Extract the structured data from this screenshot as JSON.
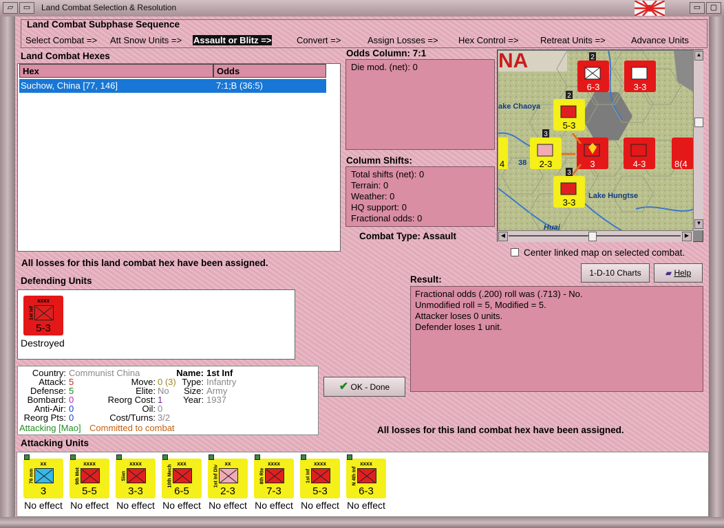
{
  "window": {
    "title": "Land Combat Selection & Resolution"
  },
  "sequence": {
    "title": "Land Combat Subphase Sequence",
    "steps": [
      "Select Combat =>",
      "Att Snow Units =>",
      "Assault or Blitz =>",
      "Convert =>",
      "Assign Losses =>",
      "Hex Control =>",
      "Retreat Units =>",
      "Advance Units"
    ],
    "active_step": "Assault or Blitz =>"
  },
  "hexes": {
    "label": "Land Combat Hexes",
    "col_hex": "Hex",
    "col_odds": "Odds",
    "rows": [
      {
        "hex": "Suchow, China [77, 146]",
        "odds": "7:1;B (36:5)"
      }
    ]
  },
  "odds": {
    "title": "Odds Column: 7:1",
    "die_mod": "Die mod. (net): 0"
  },
  "shifts": {
    "title": "Column Shifts:",
    "lines": [
      "Total shifts (net): 0",
      "Terrain: 0",
      "Weather: 0",
      "HQ support: 0",
      "Fractional odds: 0"
    ]
  },
  "combat_type": "Combat Type:  Assault",
  "center_map_label": "Center linked map on selected combat.",
  "losses_msg": "All losses for this land combat hex have been assigned.",
  "losses_msg2": "All losses for this land combat hex have been assigned.",
  "buttons": {
    "charts": "1-D-10 Charts",
    "help": "Help",
    "done": "OK - Done"
  },
  "result": {
    "title": "Result:",
    "lines": [
      "Fractional odds (.200) roll was (.713)  - No.",
      "Unmodified roll = 5, Modified = 5.",
      "Attacker loses 0 units.",
      "Defender loses 1 unit."
    ]
  },
  "defending": {
    "label": "Defending Units",
    "unit": {
      "size": "xxxx",
      "name": "1st Inf",
      "strength": "5-3",
      "status": "Destroyed"
    }
  },
  "info": {
    "country_l": "Country:",
    "country_v": "Communist China",
    "attack_l": "Attack:",
    "attack_v": "5",
    "defense_l": "Defense:",
    "defense_v": "5",
    "bombard_l": "Bombard:",
    "bombard_v": "0",
    "antiair_l": "Anti-Air:",
    "antiair_v": "0",
    "reorg_l": "Reorg Pts:",
    "reorg_v": "0",
    "move_l": "Move:",
    "move_v": "0 (3)",
    "elite_l": "Elite:",
    "elite_v": "No",
    "reorgcost_l": "Reorg Cost:",
    "reorgcost_v": "1",
    "oil_l": "Oil:",
    "oil_v": "0",
    "costturns_l": "Cost/Turns:",
    "costturns_v": "3/2",
    "name_l": "Name:",
    "name_v": "1st Inf",
    "type_l": "Type:",
    "type_v": "Infantry",
    "size_l": "Size:",
    "size_v": "Army",
    "year_l": "Year:",
    "year_v": "1937",
    "attacking_v": "Attacking [Mao]",
    "committed_v": "Committed to combat"
  },
  "attacking": {
    "label": "Attacking Units",
    "units": [
      {
        "size": "xx",
        "name": "76 mm",
        "strength": "3",
        "effect": "No effect"
      },
      {
        "size": "xxxx",
        "name": "9th Mot",
        "strength": "5-5",
        "effect": "No effect"
      },
      {
        "size": "xxxx",
        "name": "Sian",
        "strength": "3-3",
        "effect": "No effect"
      },
      {
        "size": "xxx",
        "name": "10th Mech",
        "strength": "6-5",
        "effect": "No effect"
      },
      {
        "size": "xx",
        "name": "1st Inf Div",
        "strength": "2-3",
        "effect": "No effect"
      },
      {
        "size": "xxxx",
        "name": "8th Rte",
        "strength": "7-3",
        "effect": "No effect"
      },
      {
        "size": "xxxx",
        "name": "1st Inf",
        "strength": "5-3",
        "effect": "No effect"
      },
      {
        "size": "xxxx",
        "name": "N 4th Inf",
        "strength": "6-3",
        "effect": "No effect"
      }
    ]
  },
  "map": {
    "labels": [
      "ake Chaoya",
      "Lake Hungtse",
      "Huai",
      "NA",
      "38"
    ],
    "units": [
      {
        "size": "xxxx",
        "name": "11th Inf",
        "strength": "6-3",
        "stack": "2"
      },
      {
        "size": "xxx",
        "name": "",
        "strength": "3-3",
        "stack": ""
      },
      {
        "size": "xxxx",
        "name": "1st Inf",
        "strength": "5-3",
        "stack": "2"
      },
      {
        "size": "xx",
        "name": "1st Inf Div",
        "strength": "2-3",
        "stack": "3"
      },
      {
        "size": "xxxx",
        "name": "",
        "strength": "3",
        "stack": "3"
      },
      {
        "size": "xxxx",
        "name": "",
        "strength": "4-3",
        "stack": ""
      },
      {
        "size": "xx",
        "name": "",
        "strength": "4",
        "stack": ""
      },
      {
        "size": "xxxx",
        "name": "",
        "strength": "8(4",
        "stack": "3"
      },
      {
        "size": "xxxx",
        "name": "Sian",
        "strength": "3-3",
        "stack": "3"
      }
    ]
  }
}
